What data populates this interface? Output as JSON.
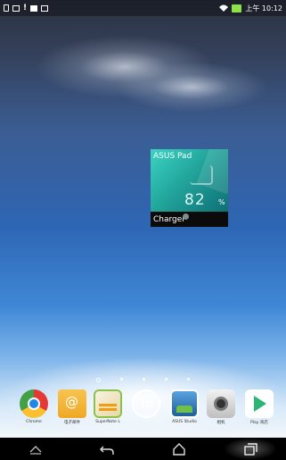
{
  "status_bar": {
    "left_icons": [
      "document-icon",
      "signal-edit-icon",
      "alert-icon",
      "message-icon",
      "image-icon"
    ],
    "alert_text": "!",
    "right_icons": [
      "wifi-icon",
      "battery-icon"
    ],
    "time": "上午 10:12",
    "battery_color": "#8de24a"
  },
  "widget": {
    "title": "ASUS Pad",
    "value": "82",
    "unit": "%",
    "label": "Charger",
    "accent": "#22a69c"
  },
  "pager": {
    "page_count": 5,
    "current_index": 0
  },
  "dock": {
    "apps": [
      {
        "label": "Chrome",
        "icon": "chrome-icon"
      },
      {
        "label": "电子邮件",
        "icon": "email-icon"
      },
      {
        "label": "SuperNote L",
        "icon": "supernote-icon"
      },
      {
        "label": "",
        "icon": "app-drawer-icon"
      },
      {
        "label": "ASUS Studio",
        "icon": "asus-studio-icon"
      },
      {
        "label": "相机",
        "icon": "camera-icon"
      },
      {
        "label": "Play 商店",
        "icon": "play-store-icon"
      }
    ]
  },
  "nav_bar": {
    "buttons": [
      "menu-icon",
      "back-icon",
      "home-icon",
      "recents-icon"
    ]
  }
}
